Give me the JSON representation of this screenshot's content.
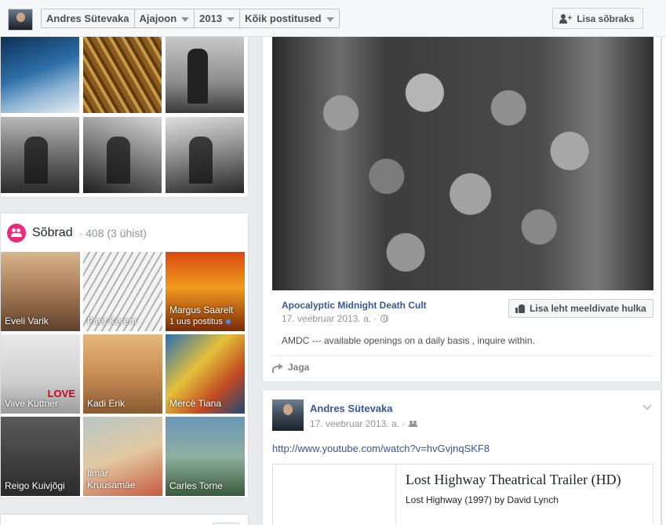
{
  "header": {
    "profile_name": "Andres Sütevaka",
    "timeline_label": "Ajajoon",
    "year_label": "2013",
    "filter_label": "Kõik postitused",
    "add_friend_label": "Lisa sõbraks"
  },
  "friends": {
    "title": "Sõbrad",
    "count": "· 408 (3 ühist)",
    "items": [
      {
        "name": "Eveli Varik"
      },
      {
        "name": "Piret Kerem"
      },
      {
        "name": "Margus Saarelt",
        "sub": "1 uus postitus"
      },
      {
        "name": "Viive Küttner",
        "overlay": "LOVE"
      },
      {
        "name": "Kadi Erik"
      },
      {
        "name": "Mercè Tiana"
      },
      {
        "name": "Reigo Kuivjõgi"
      },
      {
        "name": "Ilmar Kruusamäe"
      },
      {
        "name": "Carles Torne"
      }
    ]
  },
  "post1": {
    "page_name": "Apocalyptic Midnight Death Cult",
    "date": "17. veebruar 2013. a. ·",
    "like_page_label": "Lisa leht meeldivate hulka",
    "text": "AMDC --- available openings on a daily basis , inquire within.",
    "share_label": "Jaga"
  },
  "post2": {
    "author": "Andres Sütevaka",
    "date": "17. veebruar 2013. a. ·",
    "link": "http://www.youtube.com/watch?v=hvGvjnqSKF8",
    "attachment_title": "Lost Highway Theatrical Trailer (HD)",
    "attachment_subtitle": "Lost Highway (1997) by David Lynch"
  },
  "colors": {
    "accent": "#365899",
    "friends_icon": "#f0287b",
    "background": "#e9ebee"
  }
}
